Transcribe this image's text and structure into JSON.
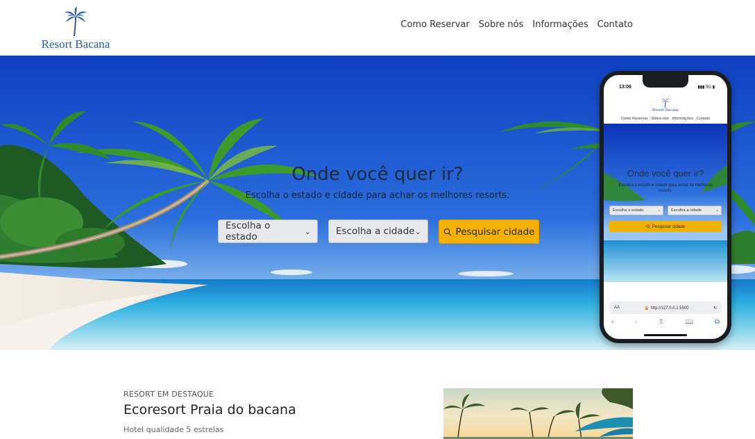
{
  "header": {
    "logo_text": "Resort Bacana",
    "nav": [
      "Como Reservar",
      "Sobre nós",
      "Informações",
      "Contato"
    ]
  },
  "hero": {
    "title": "Onde você quer ir?",
    "subtitle": "Escolha o estado e cidade para achar os melhores resorts.",
    "state_select": "Escolha o estado",
    "city_select": "Escolha a cidade",
    "search_button": "Pesquisar cidade"
  },
  "phone": {
    "time": "13:06",
    "status": "5G",
    "logo_text": "Resort Bacana",
    "nav": [
      "Como Reservar",
      "Sobre nós",
      "Informações",
      "Contato"
    ],
    "title": "Onde você quer ir?",
    "subtitle": "Escolha o estado e cidade para achar os melhores resorts.",
    "state_select": "Escolha o estado",
    "city_select": "Escolha a cidade",
    "search_button": "Pesquisar cidade",
    "aa": "AA",
    "url": "http://127.0.0.1:5500"
  },
  "featured": {
    "kicker": "RESORT EM DESTAQUE",
    "title": "Ecoresort Praia do bacana",
    "subtitle": "Hotel qualidade 5 estrelas"
  },
  "colors": {
    "brand": "#2b5ea8",
    "accent": "#f5b100",
    "sky": "#1f55c9",
    "sea": "#3ab8dc"
  },
  "icons": [
    "palm-logo-icon",
    "chevron-down-icon",
    "search-icon",
    "lock-icon",
    "reload-icon",
    "back-icon",
    "forward-icon",
    "share-icon",
    "bookmarks-icon",
    "tabs-icon"
  ]
}
